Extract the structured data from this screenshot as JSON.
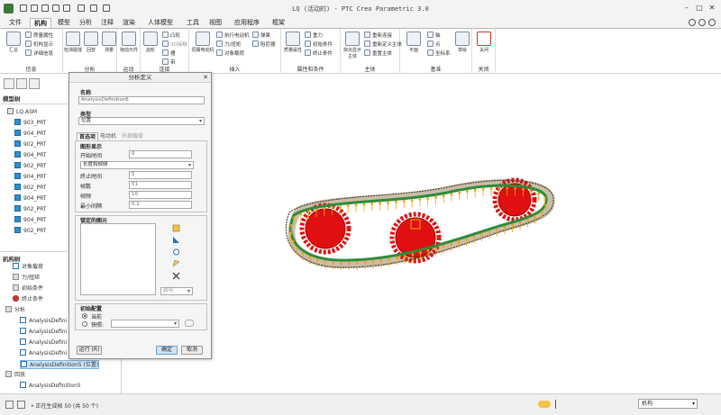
{
  "window": {
    "title": "LQ (活动的) - PTC Creo Parametric 3.0"
  },
  "ribbon_tabs": [
    "文件",
    "机构",
    "模型",
    "分析",
    "注释",
    "渲染",
    "人体模型",
    "工具",
    "视图",
    "应用程序",
    "框架"
  ],
  "active_tab": "机构",
  "ribbon": {
    "info": {
      "label": "信息",
      "big": "汇总",
      "items": [
        "质量属性",
        "机构显示",
        "详细信息"
      ]
    },
    "analysis": {
      "label": "分析",
      "items": [
        "检测碰撞",
        "回放",
        "测量"
      ]
    },
    "motion": {
      "label": "运动",
      "big": "拖动元件"
    },
    "connections": {
      "label": "连接",
      "items": [
        "齿轮",
        "凸轮",
        "3D接触",
        "槽",
        "带"
      ]
    },
    "insert": {
      "label": "插入",
      "items": [
        "伺服电动机",
        "执行电动机",
        "力/扭矩",
        "对象载荷",
        "弹簧",
        "阻尼器"
      ]
    },
    "properties": {
      "label": "属性和条件",
      "items": [
        "质量属性",
        "重力",
        "初始条件",
        "终止条件"
      ]
    },
    "body": {
      "label": "主体",
      "items": [
        "突出显示主体",
        "重新连接",
        "重新定义主体",
        "重置主体"
      ]
    },
    "datum": {
      "label": "基准",
      "items": [
        "平面",
        "轴",
        "点",
        "坐标系",
        "草绘"
      ]
    },
    "close": {
      "label": "关闭",
      "big": "关闭"
    }
  },
  "left_panel": {
    "model_tree_header": "模型树",
    "model_tree": [
      {
        "label": "LQ.ASM",
        "type": "asm"
      },
      {
        "label": "903_PRT",
        "type": "part"
      },
      {
        "label": "904_PRT",
        "type": "part"
      },
      {
        "label": "902_PRT",
        "type": "part"
      },
      {
        "label": "904_PRT",
        "type": "part"
      },
      {
        "label": "902_PRT",
        "type": "part"
      },
      {
        "label": "904_PRT",
        "type": "part"
      },
      {
        "label": "902_PRT",
        "type": "part"
      },
      {
        "label": "904_PRT",
        "type": "part"
      },
      {
        "label": "902_PRT",
        "type": "part"
      },
      {
        "label": "904_PRT",
        "type": "part"
      },
      {
        "label": "902_PRT",
        "type": "part"
      }
    ],
    "mech_tree_header": "机构树",
    "mech_tree": [
      {
        "label": "对象载荷",
        "type": "ana",
        "indent": 1
      },
      {
        "label": "力/扭矩",
        "type": "grey",
        "indent": 1
      },
      {
        "label": "初始条件",
        "type": "grey",
        "indent": 1
      },
      {
        "label": "终止条件",
        "type": "red",
        "indent": 1
      },
      {
        "label": "分析",
        "type": "grey",
        "indent": 0
      },
      {
        "label": "AnalysisDefini",
        "type": "ana",
        "indent": 2
      },
      {
        "label": "AnalysisDefini",
        "type": "ana",
        "indent": 2
      },
      {
        "label": "AnalysisDefini",
        "type": "ana",
        "indent": 2
      },
      {
        "label": "AnalysisDefini",
        "type": "ana",
        "indent": 2
      },
      {
        "label": "AnalysisDefinition5 (位置)",
        "type": "ana",
        "indent": 2,
        "selected": true
      },
      {
        "label": "回放",
        "type": "grey",
        "indent": 0
      },
      {
        "label": "AnalysisDefinition5",
        "type": "ana",
        "indent": 2
      }
    ]
  },
  "dialog": {
    "title": "分析定义",
    "name_label": "名称",
    "name_value": "AnalysisDefinition6",
    "type_label": "类型",
    "type_value": "位置",
    "tabs": [
      "首选项",
      "电动机",
      "外部载荷"
    ],
    "graph_display": "图形显示",
    "start_time_label": "开始时间",
    "start_time_value": "0",
    "length_rate_value": "长度和帧频",
    "end_time_label": "终止时间",
    "end_time_value": "5",
    "frames_label": "帧数",
    "frames_value": "51",
    "frame_rate_label": "帧频",
    "frame_rate_value": "10",
    "min_interval_label": "最小间隔",
    "min_interval_value": "0.1",
    "locked_label": "锁定的图元",
    "enable_label": "启用",
    "initial_config_label": "初始配置",
    "current_label": "当前",
    "snapshot_label": "快照:",
    "run_label": "运行 (R)",
    "ok_label": "确定",
    "cancel_label": "取消"
  },
  "statusbar": {
    "message": "• 正在生成帧 50 (共 50 个)",
    "filter_value": "机构"
  },
  "colors": {
    "gear_red": "#e01010",
    "belt_green": "#2e8b3a",
    "force_orange": "#f2a017",
    "accent_blue": "#2a6fb3"
  }
}
